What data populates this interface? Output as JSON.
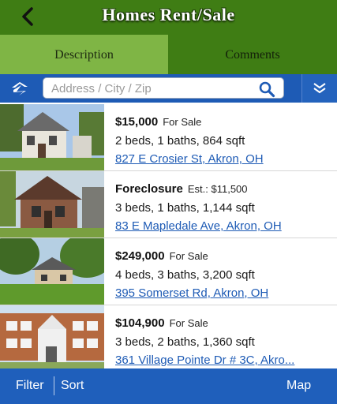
{
  "header": {
    "title": "Homes Rent/Sale"
  },
  "tabs": [
    {
      "label": "Description",
      "selected": true
    },
    {
      "label": "Comments",
      "selected": false
    }
  ],
  "search": {
    "placeholder": "Address / City / Zip"
  },
  "listings": [
    {
      "price": "$15,000",
      "status": "For Sale",
      "details": "2 beds, 1 baths, 864 sqft",
      "address": "827 E Crosier St, Akron, OH"
    },
    {
      "price": "Foreclosure",
      "status": "Est.: $11,500",
      "details": "3 beds, 1 baths, 1,144 sqft",
      "address": "83 E Mapledale Ave, Akron, OH"
    },
    {
      "price": "$249,000",
      "status": "For Sale",
      "details": "4 beds, 3 baths, 3,200 sqft",
      "address": "395 Somerset Rd, Akron, OH"
    },
    {
      "price": "$104,900",
      "status": "For Sale",
      "details": "3 beds, 2 baths, 1,360 sqft",
      "address": "361 Village Pointe Dr # 3C, Akro..."
    }
  ],
  "bottom": {
    "filter": "Filter",
    "sort": "Sort",
    "map": "Map"
  },
  "colors": {
    "header": "#3f7d14",
    "tab_selected": "#7fb545",
    "blue": "#1e5bb5"
  }
}
